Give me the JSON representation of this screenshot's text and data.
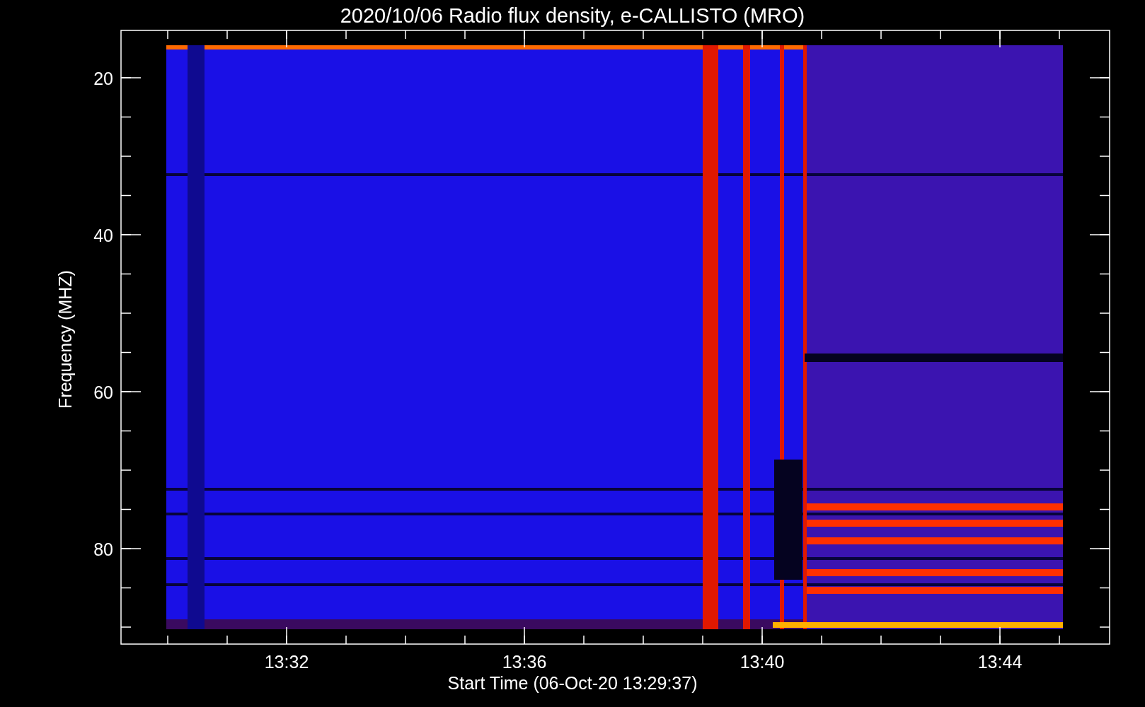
{
  "title": "2020/10/06  Radio flux density, e-CALLISTO (MRO)",
  "y_axis": {
    "label": "Frequency (MHZ)",
    "ticks": [
      "20",
      "40",
      "60",
      "80"
    ]
  },
  "x_axis": {
    "label": "Start Time (06-Oct-20 13:29:37)",
    "ticks": [
      "13:32",
      "13:36",
      "13:40",
      "13:44"
    ]
  }
}
